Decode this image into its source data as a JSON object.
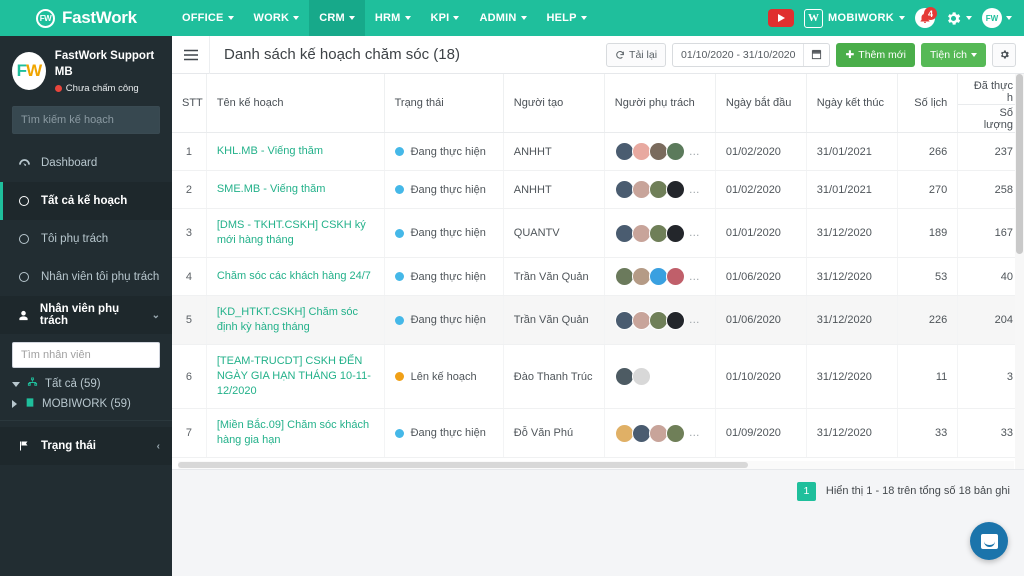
{
  "topnav": {
    "brand": {
      "logo_text": "FW",
      "name": "FastWork"
    },
    "menu": [
      {
        "label": "OFFICE",
        "active": false
      },
      {
        "label": "WORK",
        "active": false
      },
      {
        "label": "CRM",
        "active": true
      },
      {
        "label": "HRM",
        "active": false
      },
      {
        "label": "KPI",
        "active": false
      },
      {
        "label": "ADMIN",
        "active": false
      },
      {
        "label": "HELP",
        "active": false
      }
    ],
    "right": {
      "mobiwork_label": "MOBIWORK",
      "notification_count": "4",
      "avatar_text": "FW",
      "w_icon_text": "W"
    }
  },
  "sidebar": {
    "profile": {
      "avatar_f": "F",
      "avatar_w": "W",
      "name": "FastWork Support MB",
      "status": "Chưa chấm công"
    },
    "search_placeholder": "Tìm kiếm kế hoạch",
    "search_value": "",
    "items": [
      {
        "label": "Dashboard",
        "icon": "dashboard-icon",
        "active": false
      },
      {
        "label": "Tất cả kế hoạch",
        "icon": "circle-icon",
        "active": true
      },
      {
        "label": "Tôi phụ trách",
        "icon": "circle-icon",
        "active": false
      },
      {
        "label": "Nhân viên tôi phụ trách",
        "icon": "circle-icon",
        "active": false
      }
    ],
    "assignee_section": {
      "label": "Nhân viên phụ trách",
      "search_placeholder": "Tìm nhân viên",
      "search_value": "",
      "tree": [
        {
          "label": "Tất cả (59)",
          "expanded": true
        },
        {
          "label": "MOBIWORK (59)",
          "expanded": false
        }
      ]
    },
    "status_section": {
      "label": "Trạng thái"
    }
  },
  "page": {
    "title": "Danh sách kế hoạch chăm sóc (18)",
    "toolbar": {
      "reload_label": "Tải lại",
      "date_range": "01/10/2020 - 31/10/2020",
      "add_label": "Thêm mới",
      "utility_label": "Tiện ích"
    }
  },
  "table": {
    "columns": [
      "STT",
      "Tên kế hoạch",
      "Trạng thái",
      "Người tạo",
      "Người phụ trách",
      "Ngày bắt đầu",
      "Ngày kết thúc",
      "Số lịch"
    ],
    "group_header": "Đã thực h",
    "sub_header": "Số lượng",
    "rows": [
      {
        "stt": "1",
        "plan": "KHL.MB - Viếng thăm",
        "status": "Đang thực hiện",
        "status_color": "#45b8e8",
        "creator": "ANHHT",
        "avatars": [
          "#4a5c70",
          "#e8a9a0",
          "#7a6b5d",
          "#5b7a5b"
        ],
        "avatar_more": true,
        "start": "01/02/2020",
        "end": "31/01/2021",
        "count": "266",
        "done": "237",
        "alt": false
      },
      {
        "stt": "2",
        "plan": "SME.MB - Viếng thăm",
        "status": "Đang thực hiện",
        "status_color": "#45b8e8",
        "creator": "ANHHT",
        "avatars": [
          "#4a5c70",
          "#c8a49a",
          "#6f7f58",
          "#23262b"
        ],
        "avatar_more": true,
        "start": "01/02/2020",
        "end": "31/01/2021",
        "count": "270",
        "done": "258",
        "alt": false
      },
      {
        "stt": "3",
        "plan": "[DMS - TKHT.CSKH] CSKH ký mới hàng tháng",
        "status": "Đang thực hiện",
        "status_color": "#45b8e8",
        "creator": "QUANTV",
        "avatars": [
          "#4a5c70",
          "#c8a49a",
          "#6f7f58",
          "#23262b"
        ],
        "avatar_more": true,
        "start": "01/01/2020",
        "end": "31/12/2020",
        "count": "189",
        "done": "167",
        "alt": false
      },
      {
        "stt": "4",
        "plan": "Chăm sóc các khách hàng 24/7",
        "status": "Đang thực hiện",
        "status_color": "#45b8e8",
        "creator": "Trần Văn Quản",
        "avatars": [
          "#6b7a5c",
          "#b59b86",
          "#3aa0e0",
          "#c05f6a"
        ],
        "avatar_more": true,
        "start": "01/06/2020",
        "end": "31/12/2020",
        "count": "53",
        "done": "40",
        "alt": false
      },
      {
        "stt": "5",
        "plan": "[KD_HTKT.CSKH] Chăm sóc định kỳ hàng tháng",
        "status": "Đang thực hiện",
        "status_color": "#45b8e8",
        "creator": "Trần Văn Quản",
        "avatars": [
          "#4a5c70",
          "#c8a49a",
          "#6f7f58",
          "#23262b"
        ],
        "avatar_more": true,
        "start": "01/06/2020",
        "end": "31/12/2020",
        "count": "226",
        "done": "204",
        "alt": true
      },
      {
        "stt": "6",
        "plan": "[TEAM-TRUCDT] CSKH ĐẾN NGÀY GIA HẠN THÁNG 10-11-12/2020",
        "status": "Lên kế hoạch",
        "status_color": "#f0a017",
        "creator": "Đào Thanh Trúc",
        "avatars": [
          "#4d5b63",
          "#d8d8d8"
        ],
        "avatar_more": false,
        "start": "01/10/2020",
        "end": "31/12/2020",
        "count": "11",
        "done": "3",
        "alt": false
      },
      {
        "stt": "7",
        "plan": "[Miền Bắc.09] Chăm sóc khách hàng gia hạn",
        "status": "Đang thực hiện",
        "status_color": "#45b8e8",
        "creator": "Đỗ Văn Phú",
        "avatars": [
          "#e0b066",
          "#4a5c70",
          "#c8a49a",
          "#6f7f58"
        ],
        "avatar_more": true,
        "start": "01/09/2020",
        "end": "31/12/2020",
        "count": "33",
        "done": "33",
        "alt": false
      }
    ]
  },
  "pager": {
    "current_page": "1",
    "info": "Hiển thị 1 - 18 trên tổng số 18 bản ghi"
  },
  "colors": {
    "brand_green": "#1fbf9c",
    "sidebar_dark": "#222d32",
    "link_green": "#23b18a",
    "chat_blue": "#1b74ab"
  }
}
